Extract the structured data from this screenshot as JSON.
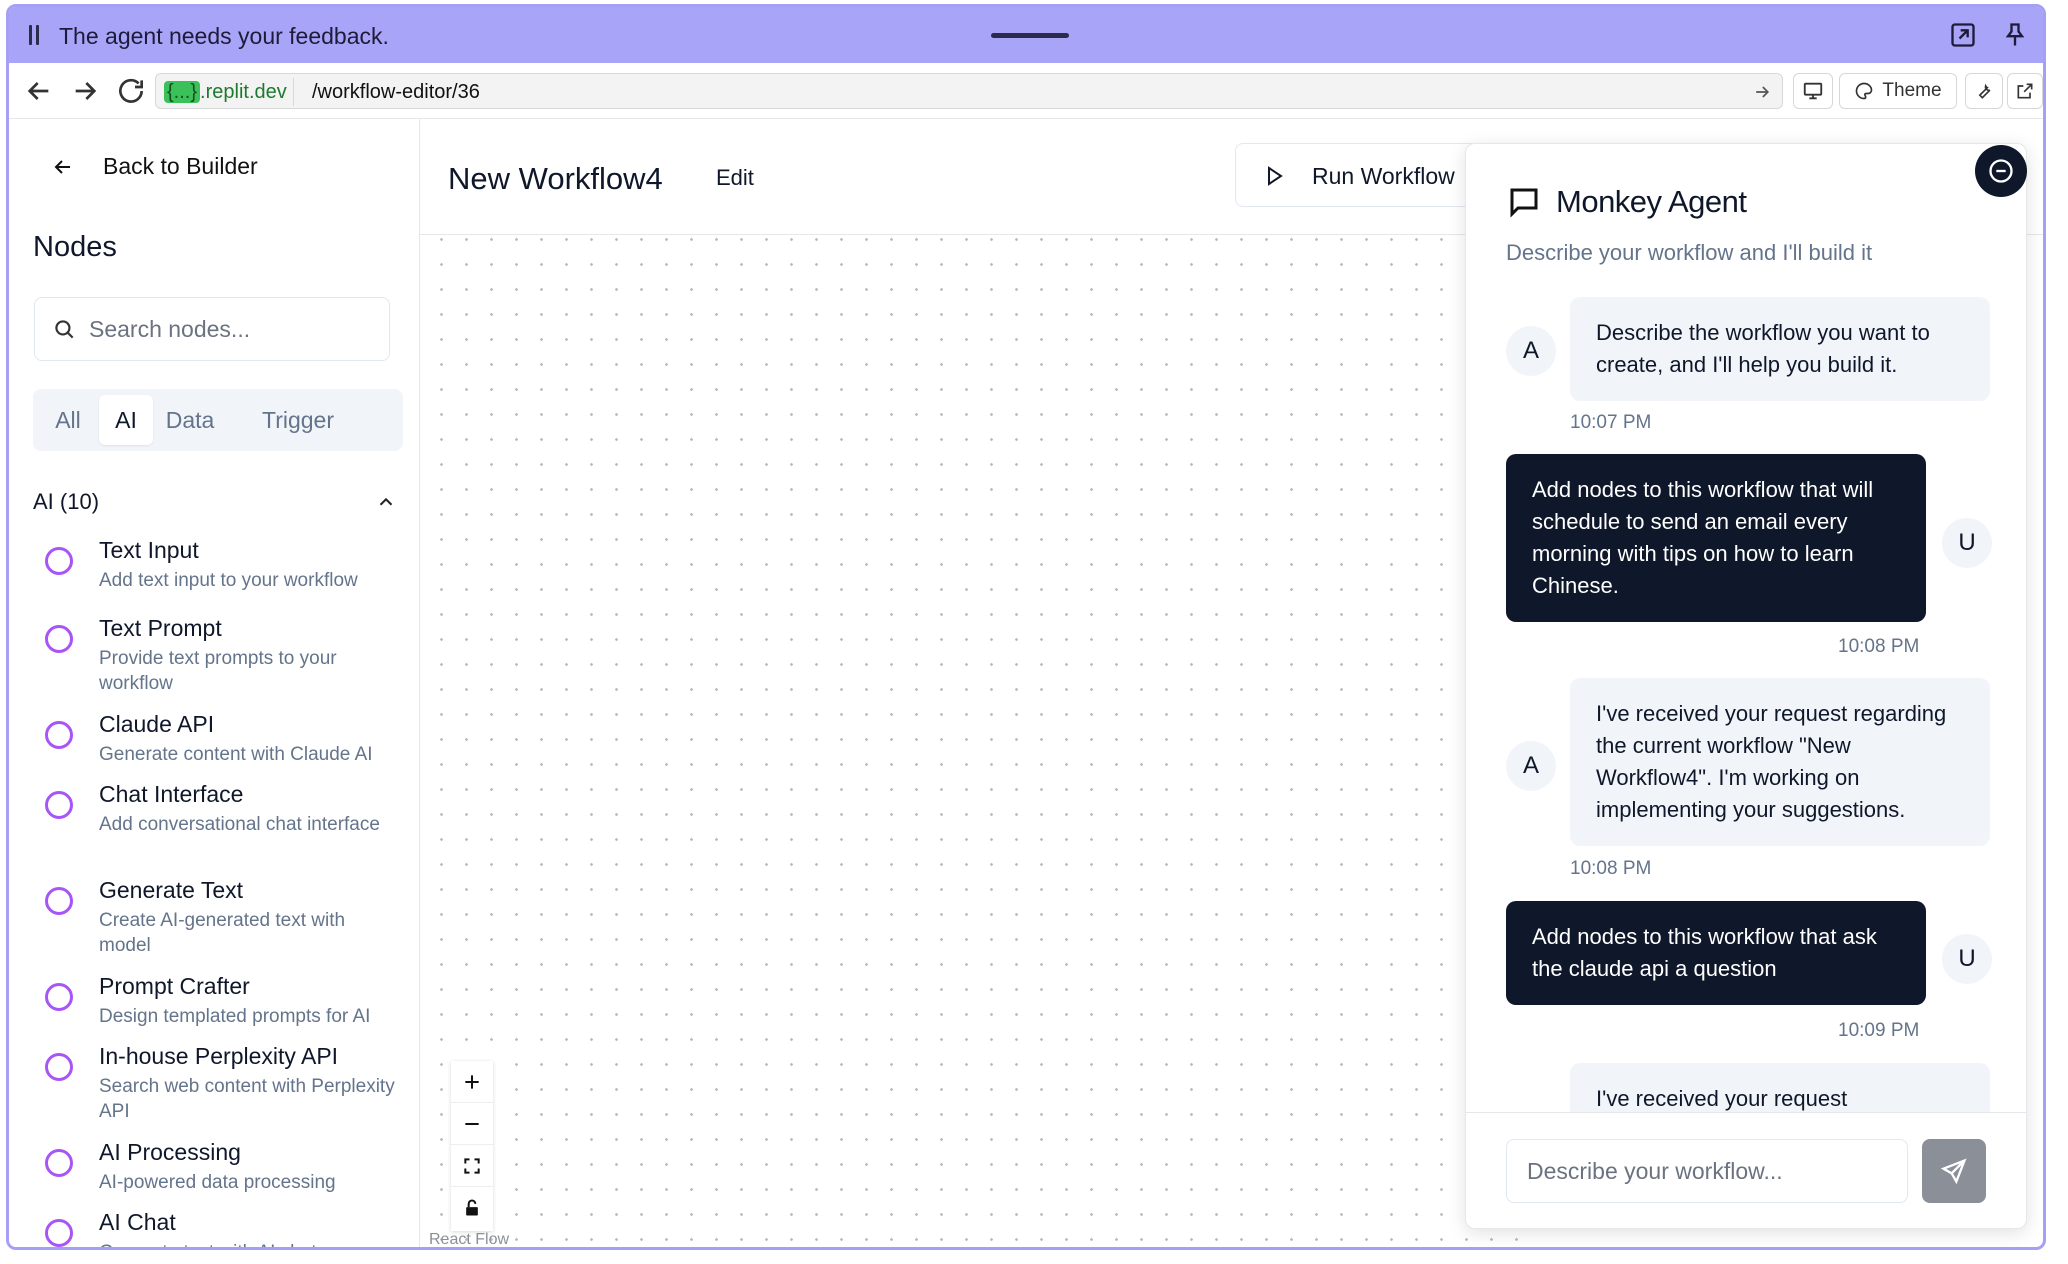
{
  "banner": {
    "message": "The agent needs your feedback."
  },
  "browser": {
    "host_tag": "{...}",
    "host": ".replit.dev",
    "path": "/workflow-editor/36",
    "theme_label": "Theme"
  },
  "sidebar": {
    "back_label": "Back to Builder",
    "title": "Nodes",
    "search_placeholder": "Search nodes...",
    "tabs": [
      {
        "label": "All"
      },
      {
        "label": "AI"
      },
      {
        "label": "Data"
      },
      {
        "label": "Trigger"
      }
    ],
    "active_tab": "AI",
    "section_label": "AI (10)",
    "nodes": [
      {
        "title": "Text Input",
        "desc": "Add text input to your workflow"
      },
      {
        "title": "Text Prompt",
        "desc": "Provide text prompts to your workflow"
      },
      {
        "title": "Claude API",
        "desc": "Generate content with Claude AI"
      },
      {
        "title": "Chat Interface",
        "desc": "Add conversational chat interface"
      },
      {
        "title": "Generate Text",
        "desc": "Create AI-generated text with model"
      },
      {
        "title": "Prompt Crafter",
        "desc": "Design templated prompts for AI"
      },
      {
        "title": "In-house Perplexity API",
        "desc": "Search web content with Perplexity API"
      },
      {
        "title": "AI Processing",
        "desc": "AI-powered data processing"
      },
      {
        "title": "AI Chat",
        "desc": "Generate text with AI chat"
      }
    ]
  },
  "header": {
    "workflow_title": "New Workflow4",
    "edit_label": "Edit",
    "run_label": "Run Workflow"
  },
  "canvas": {
    "attribution": "React Flow"
  },
  "chat": {
    "title": "Monkey Agent",
    "subtitle": "Describe your workflow and I'll build it",
    "messages": [
      {
        "role": "agent",
        "avatar": "A",
        "text": "Describe the workflow you want to create, and I'll help you build it.",
        "time": "10:07 PM"
      },
      {
        "role": "user",
        "avatar": "U",
        "text": "Add nodes to this workflow that will schedule to send an email every morning with tips on how to learn Chinese.",
        "time": "10:08 PM"
      },
      {
        "role": "agent",
        "avatar": "A",
        "text": "I've received your request regarding the current workflow \"New Workflow4\". I'm working on implementing your suggestions.",
        "time": "10:08 PM"
      },
      {
        "role": "user",
        "avatar": "U",
        "text": "Add nodes to this workflow that ask the claude api a question",
        "time": "10:09 PM"
      },
      {
        "role": "agent",
        "avatar": "",
        "text": "I've received your request",
        "time": ""
      }
    ],
    "input_placeholder": "Describe your workflow..."
  },
  "colors": {
    "banner": "#a8a4f7",
    "accent_ring": "#a855f7",
    "user_bubble": "#0f172a",
    "agent_bubble": "#f1f5f9"
  }
}
